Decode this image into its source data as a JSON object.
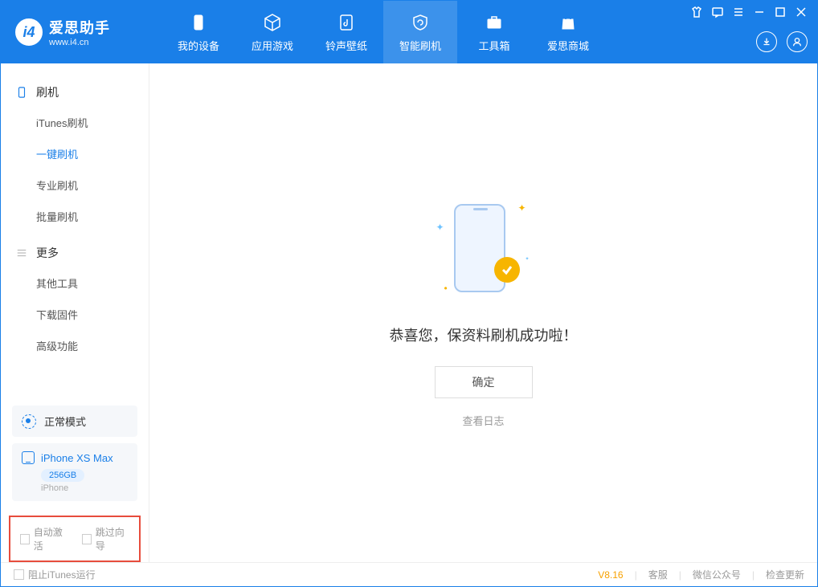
{
  "app": {
    "title": "爱思助手",
    "subtitle": "www.i4.cn"
  },
  "nav": {
    "items": [
      {
        "label": "我的设备"
      },
      {
        "label": "应用游戏"
      },
      {
        "label": "铃声壁纸"
      },
      {
        "label": "智能刷机"
      },
      {
        "label": "工具箱"
      },
      {
        "label": "爱思商城"
      }
    ]
  },
  "sidebar": {
    "section1": {
      "title": "刷机",
      "items": [
        {
          "label": "iTunes刷机"
        },
        {
          "label": "一键刷机"
        },
        {
          "label": "专业刷机"
        },
        {
          "label": "批量刷机"
        }
      ]
    },
    "section2": {
      "title": "更多",
      "items": [
        {
          "label": "其他工具"
        },
        {
          "label": "下载固件"
        },
        {
          "label": "高级功能"
        }
      ]
    }
  },
  "device": {
    "mode": "正常模式",
    "name": "iPhone XS Max",
    "storage": "256GB",
    "type": "iPhone"
  },
  "options": {
    "auto_activate": "自动激活",
    "skip_guide": "跳过向导"
  },
  "main": {
    "title": "恭喜您，保资料刷机成功啦！",
    "confirm": "确定",
    "view_log": "查看日志"
  },
  "footer": {
    "block_itunes": "阻止iTunes运行",
    "version": "V8.16",
    "service": "客服",
    "wechat": "微信公众号",
    "update": "检查更新"
  }
}
